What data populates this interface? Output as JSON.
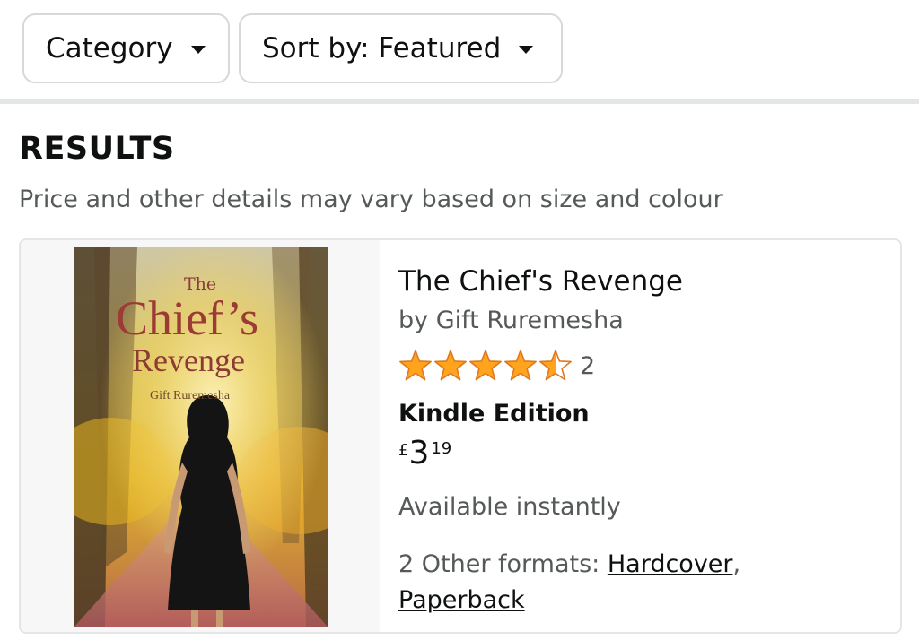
{
  "filters": {
    "category_label": "Category",
    "sort_label": "Sort by: Featured"
  },
  "results": {
    "heading": "RESULTS",
    "note": "Price and other details may vary based on size and colour"
  },
  "product": {
    "cover": {
      "title_prefix": "The",
      "title_main": "Chief’s",
      "title_sub": "Revenge",
      "author": "Gift Ruremesha"
    },
    "title": "The Chief's Revenge",
    "byline": "by Gift Ruremesha",
    "rating": {
      "stars": 4.5,
      "count": "2",
      "star_color": "#ffa41c"
    },
    "format": "Kindle Edition",
    "price": {
      "symbol": "£",
      "whole": "3",
      "fraction": "19"
    },
    "availability": "Available instantly",
    "other_formats": {
      "prefix": "2 Other formats: ",
      "links": [
        "Hardcover",
        "Paperback"
      ],
      "separator": ","
    }
  }
}
